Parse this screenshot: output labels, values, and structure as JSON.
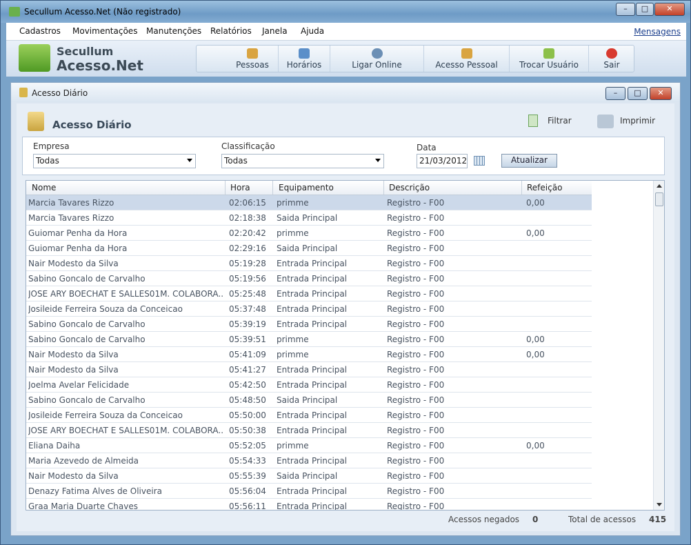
{
  "window": {
    "title": "Secullum Acesso.Net (Não registrado)",
    "min": "–",
    "max": "□",
    "close": "✕"
  },
  "menu": {
    "items": [
      "Cadastros",
      "Movimentações",
      "Manutenções",
      "Relatórios",
      "Janela",
      "Ajuda"
    ],
    "messages": "Mensagens"
  },
  "logo": {
    "line1": "Secullum",
    "line2": "Acesso.Net"
  },
  "toolbar": {
    "buttons": [
      "Pessoas",
      "Horários",
      "Ligar Online",
      "Acesso Pessoal",
      "Trocar Usuário",
      "Sair"
    ]
  },
  "panel": {
    "title": "Acesso Diário",
    "header": "Acesso Diário",
    "filter_label": "Filtrar",
    "print_label": "Imprimir",
    "empresa_label": "Empresa",
    "empresa_value": "Todas",
    "classificacao_label": "Classificação",
    "classificacao_value": "Todas",
    "data_label": "Data",
    "data_value": "21/03/2012",
    "atualizar_label": "Atualizar"
  },
  "table": {
    "columns": [
      "Nome",
      "Hora",
      "Equipamento",
      "Descrição",
      "Refeição"
    ],
    "rows": [
      [
        "Marcia Tavares Rizzo",
        "02:06:15",
        "primme",
        "Registro - F00",
        "0,00"
      ],
      [
        "Marcia Tavares Rizzo",
        "02:18:38",
        "Saida Principal",
        "Registro - F00",
        ""
      ],
      [
        "Guiomar Penha da Hora",
        "02:20:42",
        "primme",
        "Registro - F00",
        "0,00"
      ],
      [
        "Guiomar Penha da Hora",
        "02:29:16",
        "Saida Principal",
        "Registro - F00",
        ""
      ],
      [
        "Nair Modesto da Silva",
        "05:19:28",
        "Entrada Principal",
        "Registro - F00",
        ""
      ],
      [
        "Sabino Goncalo de Carvalho",
        "05:19:56",
        "Entrada Principal",
        "Registro - F00",
        ""
      ],
      [
        "JOSE ARY BOECHAT E SALLES01M. COLABORA...",
        "05:25:48",
        "Entrada Principal",
        "Registro - F00",
        ""
      ],
      [
        "Josileide Ferreira Souza da Conceicao",
        "05:37:48",
        "Entrada Principal",
        "Registro - F00",
        ""
      ],
      [
        "Sabino Goncalo de Carvalho",
        "05:39:19",
        "Entrada Principal",
        "Registro - F00",
        ""
      ],
      [
        "Sabino Goncalo de Carvalho",
        "05:39:51",
        "primme",
        "Registro - F00",
        "0,00"
      ],
      [
        "Nair Modesto da Silva",
        "05:41:09",
        "primme",
        "Registro - F00",
        "0,00"
      ],
      [
        "Nair Modesto da Silva",
        "05:41:27",
        "Entrada Principal",
        "Registro - F00",
        ""
      ],
      [
        "Joelma Avelar Felicidade",
        "05:42:50",
        "Entrada Principal",
        "Registro - F00",
        ""
      ],
      [
        "Sabino Goncalo de Carvalho",
        "05:48:50",
        "Saida Principal",
        "Registro - F00",
        ""
      ],
      [
        "Josileide Ferreira Souza da Conceicao",
        "05:50:00",
        "Entrada Principal",
        "Registro - F00",
        ""
      ],
      [
        "JOSE ARY BOECHAT E SALLES01M. COLABORA...",
        "05:50:38",
        "Entrada Principal",
        "Registro - F00",
        ""
      ],
      [
        "Eliana Daiha",
        "05:52:05",
        "primme",
        "Registro - F00",
        "0,00"
      ],
      [
        "Maria Azevedo de Almeida",
        "05:54:33",
        "Entrada Principal",
        "Registro - F00",
        ""
      ],
      [
        "Nair Modesto da Silva",
        "05:55:39",
        "Saida Principal",
        "Registro - F00",
        ""
      ],
      [
        "Denazy Fatima Alves de Oliveira",
        "05:56:04",
        "Entrada Principal",
        "Registro - F00",
        ""
      ],
      [
        "Graa Maria Duarte Chaves",
        "05:56:11",
        "Entrada Principal",
        "Registro - F00",
        ""
      ]
    ]
  },
  "footer": {
    "denied_label": "Acessos negados",
    "denied_value": "0",
    "total_label": "Total de acessos",
    "total_value": "415"
  }
}
